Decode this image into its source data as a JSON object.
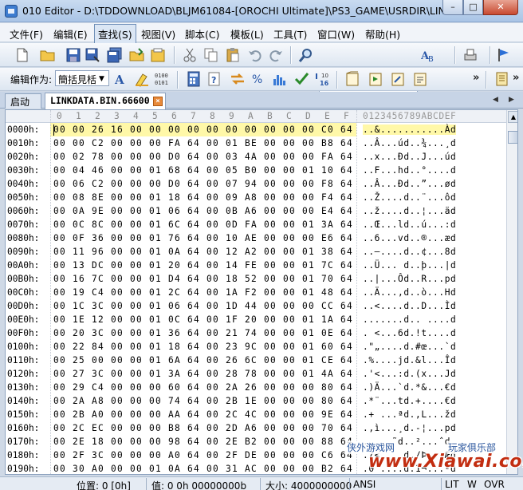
{
  "window": {
    "title": "010 Editor - D:\\TDDOWNLOAD\\BLJM61084-[OROCHI Ultimate]\\PS3_GAME\\USRDIR\\LINK...",
    "min": "–",
    "max": "□",
    "close": "✕"
  },
  "menu": [
    "文件(F)",
    "编辑(E)",
    "查找(S)",
    "视图(V)",
    "脚本(C)",
    "模板(L)",
    "工具(T)",
    "窗口(W)",
    "帮助(H)"
  ],
  "toolbar": {
    "edit_as_label": "编辑作为:",
    "edit_as_value": "簡括見栝",
    "search_value": ""
  },
  "tabs": {
    "start": "启动",
    "file": "LINKDATA.BIN.66600"
  },
  "hex": {
    "columns": [
      "0",
      "1",
      "2",
      "3",
      "4",
      "5",
      "6",
      "7",
      "8",
      "9",
      "A",
      "B",
      "C",
      "D",
      "E",
      "F"
    ],
    "ascii_header": "0123456789ABCDEF",
    "rows": [
      {
        "addr": "0000h:",
        "bytes": "00 00 26 16 00 00 00 00 00 00 00 00 00 00 C0 64",
        "ascii": "..&...........Àd"
      },
      {
        "addr": "0010h:",
        "bytes": "00 00 C2 00 00 00 FA 64 00 01 BE 00 00 00 B8 64",
        "ascii": "..Â...úd..¾...¸d"
      },
      {
        "addr": "0020h:",
        "bytes": "00 02 78 00 00 00 D0 64 00 03 4A 00 00 00 FA 64",
        "ascii": "..x...Ðd..J...úd"
      },
      {
        "addr": "0030h:",
        "bytes": "00 04 46 00 00 01 68 64 00 05 B0 00 00 01 10 64",
        "ascii": "..F...hd..°....d"
      },
      {
        "addr": "0040h:",
        "bytes": "00 06 C2 00 00 00 D0 64 00 07 94 00 00 00 F8 64",
        "ascii": "..Â...Ðd..”...ød"
      },
      {
        "addr": "0050h:",
        "bytes": "00 08 8E 00 00 01 18 64 00 09 A8 00 00 00 F4 64",
        "ascii": "..Ž....d..¨...ôd"
      },
      {
        "addr": "0060h:",
        "bytes": "00 0A 9E 00 00 01 06 64 00 0B A6 00 00 00 E4 64",
        "ascii": "..ž....d..¦...äd"
      },
      {
        "addr": "0070h:",
        "bytes": "00 0C 8C 00 00 01 6C 64 00 0D FA 00 00 01 3A 64",
        "ascii": "..Œ...ld..ú...:d"
      },
      {
        "addr": "0080h:",
        "bytes": "00 0F 36 00 00 01 76 64 00 10 AE 00 00 00 E6 64",
        "ascii": "..6...vd..®...æd"
      },
      {
        "addr": "0090h:",
        "bytes": "00 11 96 00 00 01 0A 64 00 12 A2 00 00 01 38 64",
        "ascii": "..–....d..¢...8d"
      },
      {
        "addr": "00A0h:",
        "bytes": "00 13 DC 00 00 01 20 64 00 14 FE 00 00 01 7C 64",
        "ascii": "..Ü... d..þ...|d"
      },
      {
        "addr": "00B0h:",
        "bytes": "00 16 7C 00 00 01 D4 64 00 18 52 00 00 01 70 64",
        "ascii": "..|...Ôd..R...pd"
      },
      {
        "addr": "00C0h:",
        "bytes": "00 19 C4 00 00 01 2C 64 00 1A F2 00 00 01 48 64",
        "ascii": "..Ä...,d..ò...Hd"
      },
      {
        "addr": "00D0h:",
        "bytes": "00 1C 3C 00 00 01 06 64 00 1D 44 00 00 00 CC 64",
        "ascii": "..<....d..D...Ìd"
      },
      {
        "addr": "00E0h:",
        "bytes": "00 1E 12 00 00 01 0C 64 00 1F 20 00 00 01 1A 64",
        "ascii": ".......d.. ....d"
      },
      {
        "addr": "00F0h:",
        "bytes": "00 20 3C 00 00 01 36 64 00 21 74 00 00 01 0E 64",
        "ascii": ". <...6d.!t....d"
      },
      {
        "addr": "0100h:",
        "bytes": "00 22 84 00 00 01 18 64 00 23 9C 00 00 01 60 64",
        "ascii": ".\"„....d.#œ...`d"
      },
      {
        "addr": "0110h:",
        "bytes": "00 25 00 00 00 01 6A 64 00 26 6C 00 00 01 CE 64",
        "ascii": ".%....jd.&l...Îd"
      },
      {
        "addr": "0120h:",
        "bytes": "00 27 3C 00 00 01 3A 64 00 28 78 00 00 01 4A 64",
        "ascii": ".'<...:d.(x...Jd"
      },
      {
        "addr": "0130h:",
        "bytes": "00 29 C4 00 00 00 60 64 00 2A 26 00 00 00 80 64",
        "ascii": ".)Ä...`d.*&...€d"
      },
      {
        "addr": "0140h:",
        "bytes": "00 2A A8 00 00 00 74 64 00 2B 1E 00 00 00 80 64",
        "ascii": ".*¨...td.+....€d"
      },
      {
        "addr": "0150h:",
        "bytes": "00 2B A0 00 00 00 AA 64 00 2C 4C 00 00 00 9E 64",
        "ascii": ".+ ...ªd.,L...žd"
      },
      {
        "addr": "0160h:",
        "bytes": "00 2C EC 00 00 00 B8 64 00 2D A6 00 00 00 70 64",
        "ascii": ".,ì...¸d.-¦...pd"
      },
      {
        "addr": "0170h:",
        "bytes": "00 2E 18 00 00 00 98 64 00 2E B2 00 00 00 88 64",
        "ascii": ".....˜d..²...ˆd"
      },
      {
        "addr": "0180h:",
        "bytes": "00 2F 3C 00 00 00 A0 64 00 2F DE 00 00 00 C6 64",
        "ascii": "./<... d./Þ...Æd"
      },
      {
        "addr": "0190h:",
        "bytes": "00 30 A0 00 00 01 0A 64 00 31 AC 00 00 00 B2 64",
        "ascii": ".0 ....d.1¬...²d"
      }
    ]
  },
  "watermark": {
    "left": "侠外游戏网",
    "right": "玩家俱乐部",
    "logo": "www.Xiawai.com"
  },
  "status": {
    "position": "位置: 0 [0h]",
    "value": "值: 0 0h 00000000b",
    "size": "大小: 4000000000",
    "encoding": "ANSI",
    "endian": "LIT",
    "write": "W",
    "ovr": "OVR"
  }
}
